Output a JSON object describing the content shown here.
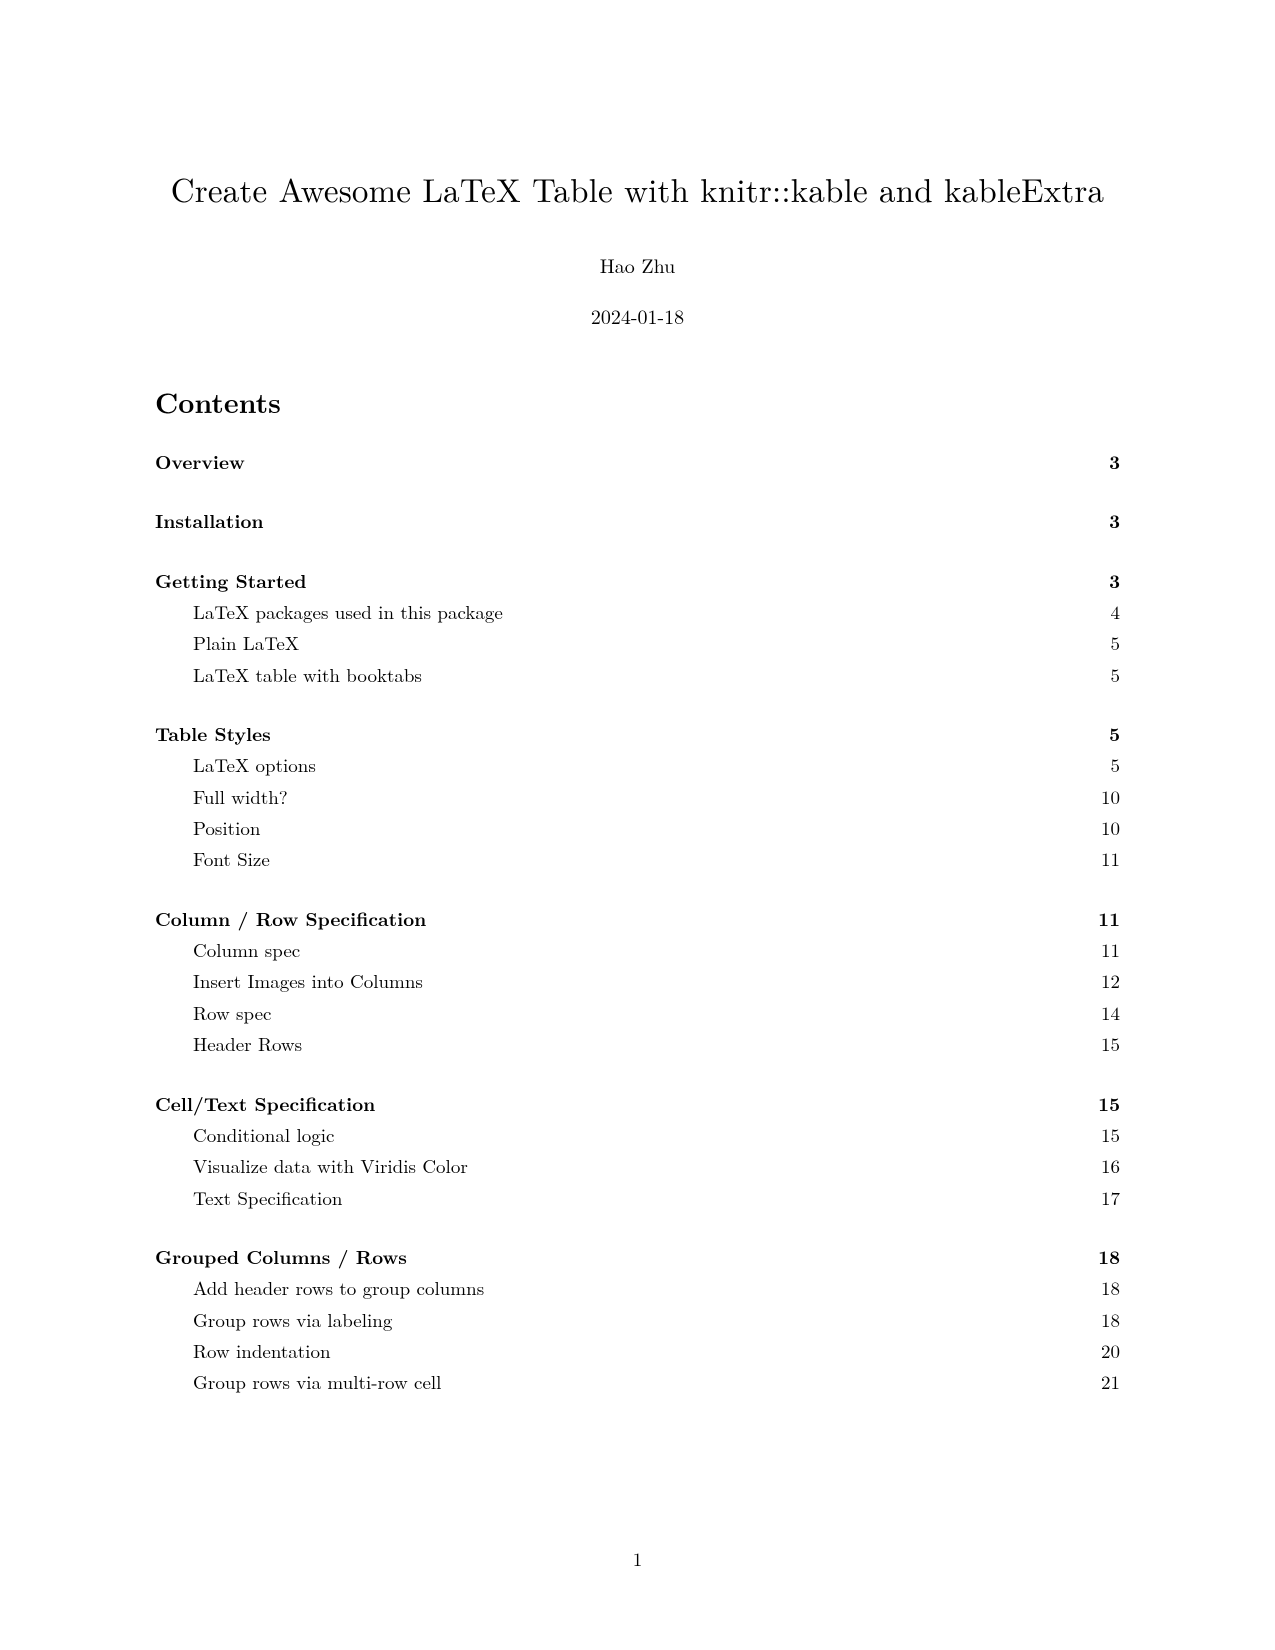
{
  "title": "Create Awesome LaTeX Table with knitr::kable and kableExtra",
  "author": "Hao Zhu",
  "date": "2024-01-18",
  "contentsHeading": "Contents",
  "pageNumber": "1",
  "toc": [
    {
      "label": "Overview",
      "page": "3",
      "subs": []
    },
    {
      "label": "Installation",
      "page": "3",
      "subs": []
    },
    {
      "label": "Getting Started",
      "page": "3",
      "subs": [
        {
          "label": "LaTeX packages used in this package",
          "page": "4"
        },
        {
          "label": "Plain LaTeX",
          "page": "5"
        },
        {
          "label": "LaTeX table with booktabs",
          "page": "5"
        }
      ]
    },
    {
      "label": "Table Styles",
      "page": "5",
      "subs": [
        {
          "label": "LaTeX options",
          "page": "5"
        },
        {
          "label": "Full width?",
          "page": "10"
        },
        {
          "label": "Position",
          "page": "10"
        },
        {
          "label": "Font Size",
          "page": "11"
        }
      ]
    },
    {
      "label": "Column / Row Specification",
      "page": "11",
      "subs": [
        {
          "label": "Column spec",
          "page": "11"
        },
        {
          "label": "Insert Images into Columns",
          "page": "12"
        },
        {
          "label": "Row spec",
          "page": "14"
        },
        {
          "label": "Header Rows",
          "page": "15"
        }
      ]
    },
    {
      "label": "Cell/Text Specification",
      "page": "15",
      "subs": [
        {
          "label": "Conditional logic",
          "page": "15"
        },
        {
          "label": "Visualize data with Viridis Color",
          "page": "16"
        },
        {
          "label": "Text Specification",
          "page": "17"
        }
      ]
    },
    {
      "label": "Grouped Columns / Rows",
      "page": "18",
      "subs": [
        {
          "label": "Add header rows to group columns",
          "page": "18"
        },
        {
          "label": "Group rows via labeling",
          "page": "18"
        },
        {
          "label": "Row indentation",
          "page": "20"
        },
        {
          "label": "Group rows via multi-row cell",
          "page": "21"
        }
      ]
    }
  ]
}
